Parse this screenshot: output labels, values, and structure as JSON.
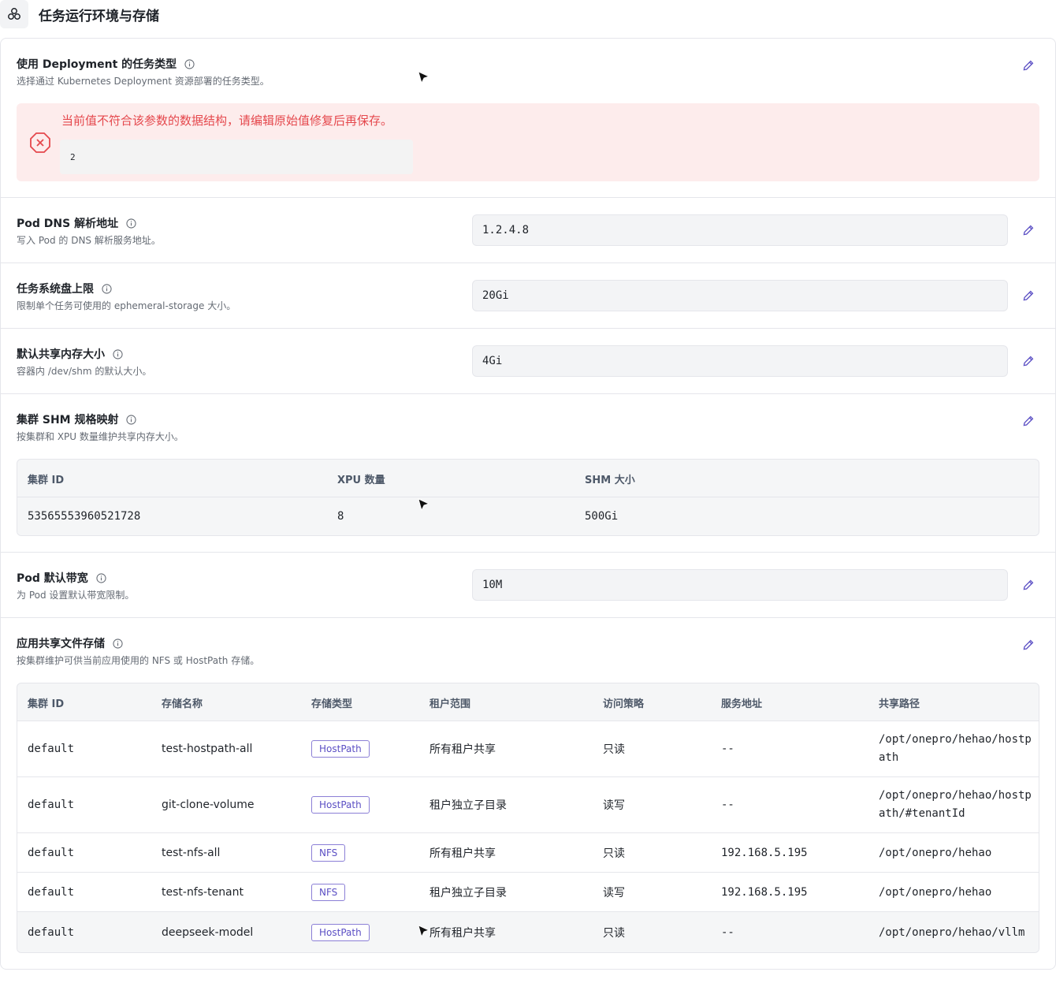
{
  "page": {
    "title": "任务运行环境与存储",
    "icon": "cluster-icon"
  },
  "deployment_types": {
    "title": "使用 Deployment 的任务类型",
    "desc": "选择通过 Kubernetes Deployment 资源部署的任务类型。",
    "error_message": "当前值不符合该参数的数据结构，请编辑原始值修复后再保存。",
    "raw_value": "2"
  },
  "pod_dns": {
    "title": "Pod DNS 解析地址",
    "desc": "写入 Pod 的 DNS 解析服务地址。",
    "value": "1.2.4.8"
  },
  "system_disk": {
    "title": "任务系统盘上限",
    "desc": "限制单个任务可使用的 ephemeral-storage 大小。",
    "value": "20Gi"
  },
  "shm_default": {
    "title": "默认共享内存大小",
    "desc": "容器内 /dev/shm 的默认大小。",
    "value": "4Gi"
  },
  "shm_map": {
    "title": "集群 SHM 规格映射",
    "desc": "按集群和 XPU 数量维护共享内存大小。",
    "columns": [
      "集群 ID",
      "XPU 数量",
      "SHM 大小"
    ],
    "rows": [
      {
        "cluster_id": "53565553960521728",
        "xpu_count": "8",
        "shm_size": "500Gi"
      }
    ]
  },
  "bandwidth": {
    "title": "Pod 默认带宽",
    "desc": "为 Pod 设置默认带宽限制。",
    "value": "10M"
  },
  "shared_storage": {
    "title": "应用共享文件存储",
    "desc": "按集群维护可供当前应用使用的 NFS 或 HostPath 存储。",
    "columns": [
      "集群 ID",
      "存储名称",
      "存储类型",
      "租户范围",
      "访问策略",
      "服务地址",
      "共享路径"
    ],
    "rows": [
      {
        "cluster": "default",
        "name": "test-hostpath-all",
        "type": "HostPath",
        "scope": "所有租户共享",
        "access": "只读",
        "server": "--",
        "path": "/opt/onepro/hehao/hostpath"
      },
      {
        "cluster": "default",
        "name": "git-clone-volume",
        "type": "HostPath",
        "scope": "租户独立子目录",
        "access": "读写",
        "server": "--",
        "path": "/opt/onepro/hehao/hostpath/#tenantId"
      },
      {
        "cluster": "default",
        "name": "test-nfs-all",
        "type": "NFS",
        "scope": "所有租户共享",
        "access": "只读",
        "server": "192.168.5.195",
        "path": "/opt/onepro/hehao"
      },
      {
        "cluster": "default",
        "name": "test-nfs-tenant",
        "type": "NFS",
        "scope": "租户独立子目录",
        "access": "读写",
        "server": "192.168.5.195",
        "path": "/opt/onepro/hehao"
      },
      {
        "cluster": "default",
        "name": "deepseek-model",
        "type": "HostPath",
        "scope": "所有租户共享",
        "access": "只读",
        "server": "--",
        "path": "/opt/onepro/hehao/vllm"
      }
    ]
  },
  "colors": {
    "accent": "#5b4fc4",
    "error": "#e5484d",
    "error_bg": "#fdecec",
    "border": "#e5e6eb"
  }
}
